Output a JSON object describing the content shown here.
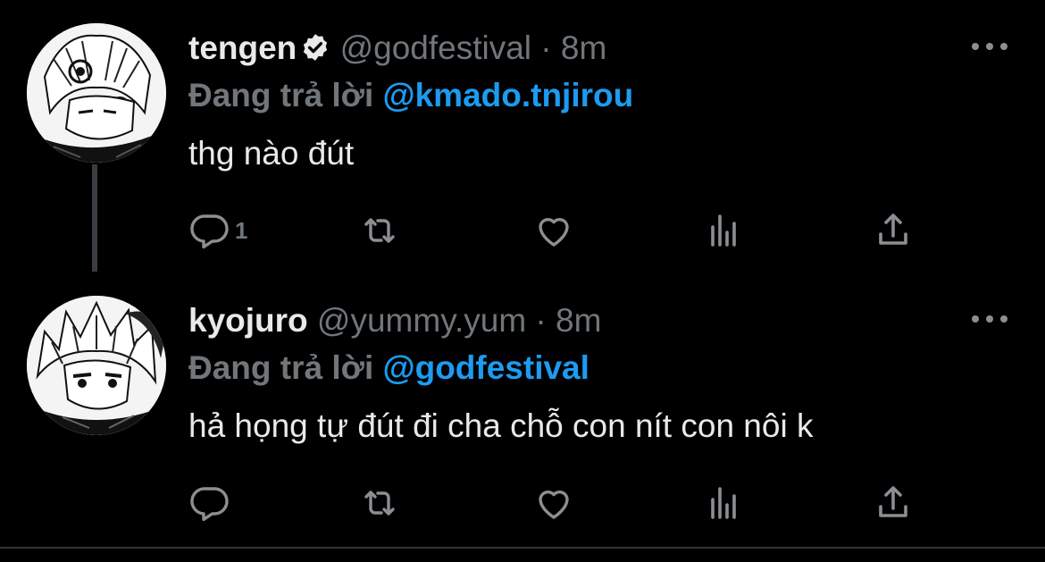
{
  "tweets": [
    {
      "name": "tengen",
      "verified": true,
      "handle": "@godfestival",
      "separator": "·",
      "time": "8m",
      "reply_prefix": "Đang trả lời",
      "reply_to": "@kmado.tnjirou",
      "text": "thg nào đút",
      "reply_count": "1",
      "avatar_icon": "manga-avatar-tengen"
    },
    {
      "name": "kyojuro",
      "verified": false,
      "handle": "@yummy.yum",
      "separator": "·",
      "time": "8m",
      "reply_prefix": "Đang trả lời",
      "reply_to": "@godfestival",
      "text": "hả họng tự đút đi cha chỗ con nít con nôi k",
      "reply_count": "",
      "avatar_icon": "manga-avatar-kyojuro"
    }
  ],
  "colors": {
    "background": "#000000",
    "text": "#e7e9ea",
    "muted": "#71767b",
    "accent": "#1d9bf0"
  }
}
